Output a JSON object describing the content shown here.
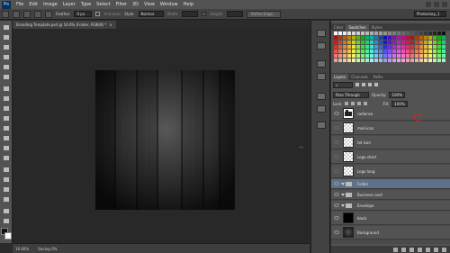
{
  "app": {
    "logo": "Ps"
  },
  "menu": [
    "File",
    "Edit",
    "Image",
    "Layer",
    "Type",
    "Select",
    "Filter",
    "3D",
    "View",
    "Window",
    "Help"
  ],
  "options": {
    "feather_label": "Feather:",
    "feather_value": "0 px",
    "antialias_label": "Anti-alias",
    "style_label": "Style:",
    "style_value": "Normal",
    "width_label": "Width:",
    "height_label": "Height:",
    "refine_edge": "Refine Edge...",
    "workspace": "Photoshop_1"
  },
  "document": {
    "tab_title": "Branding Template.psd @ 16.6% (Folder, RGB/8) *"
  },
  "status": {
    "zoom": "16.66%",
    "info": "Saving 0%"
  },
  "panels": {
    "color_tabs": [
      "Color",
      "Swatches",
      "Styles"
    ],
    "layers_tabs": [
      "Layers",
      "Channels",
      "Paths"
    ],
    "blend_mode": "Pass Through",
    "opacity_label": "Opacity:",
    "opacity_value": "100%",
    "lock_label": "Lock:",
    "fill_label": "Fill:",
    "fill_value": "100%"
  },
  "layers": [
    {
      "name": "radiance",
      "kind": "layer"
    },
    {
      "name": "mail-icon",
      "kind": "layer"
    },
    {
      "name": "tel-icon",
      "kind": "layer"
    },
    {
      "name": "Logo short",
      "kind": "layer"
    },
    {
      "name": "Logo long",
      "kind": "layer"
    },
    {
      "name": "Folder",
      "kind": "group"
    },
    {
      "name": "Business card",
      "kind": "group"
    },
    {
      "name": "Envelope",
      "kind": "group"
    },
    {
      "name": "black",
      "kind": "layer"
    },
    {
      "name": "Background",
      "kind": "layer"
    }
  ],
  "colors": {
    "chrome": "#535353",
    "workspace": "#282828",
    "selection": "#5e7189",
    "annotation": "#dd2222"
  }
}
